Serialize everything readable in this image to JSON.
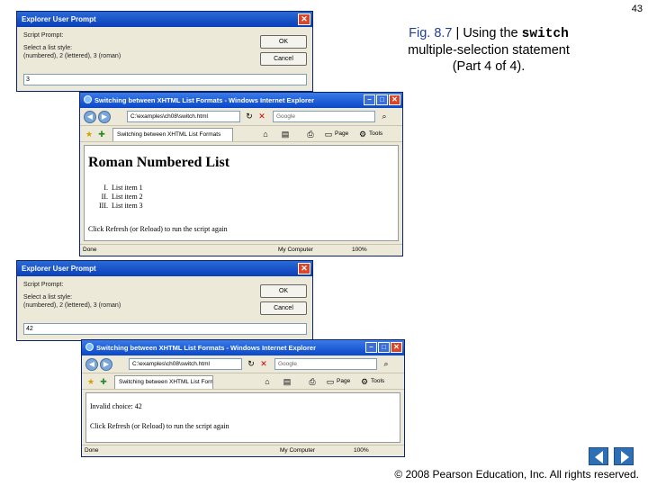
{
  "page_number": "43",
  "caption": {
    "fig": "Fig. 8.7",
    "sep": " | ",
    "text_before": "Using the ",
    "code": "switch",
    "text_after": " multiple-selection statement (Part 4 of 4)."
  },
  "dialog_title": "Explorer User Prompt",
  "dialog_script_prompt": "Script Prompt:",
  "dialog_message_line1": "Select a list style:",
  "dialog_message_line2": "(numbered), 2 (lettered), 3 (roman)",
  "dialog_ok": "OK",
  "dialog_cancel": "Cancel",
  "dialog1_value": "3",
  "dialog2_value": "42",
  "browser_title": "Switching between XHTML List Formats - Windows Internet Explorer",
  "browser_address": "C:\\examples\\ch08\\switch.html",
  "browser_search": "Google",
  "browser_tab": "Switching between XHTML List Formats",
  "toolbar_page": "Page",
  "toolbar_tools": "Tools",
  "status_done": "Done",
  "status_zone": "My Computer",
  "status_zoom": "100%",
  "window1": {
    "heading": "Roman Numbered List",
    "items": [
      {
        "numeral": "I.",
        "text": "List item 1"
      },
      {
        "numeral": "II.",
        "text": "List item 2"
      },
      {
        "numeral": "III.",
        "text": "List item 3"
      }
    ],
    "footer": "Click Refresh (or Reload) to run the script again"
  },
  "window2": {
    "invalid": "Invalid choice: 42",
    "footer": "Click Refresh (or Reload) to run the script again"
  },
  "copyright": "© 2008 Pearson Education, Inc.  All rights reserved.",
  "colors": {
    "caption_fig": "#1f3f99",
    "nav_arrow": "#2e6fb5",
    "xp_title": "#0a48c8"
  }
}
